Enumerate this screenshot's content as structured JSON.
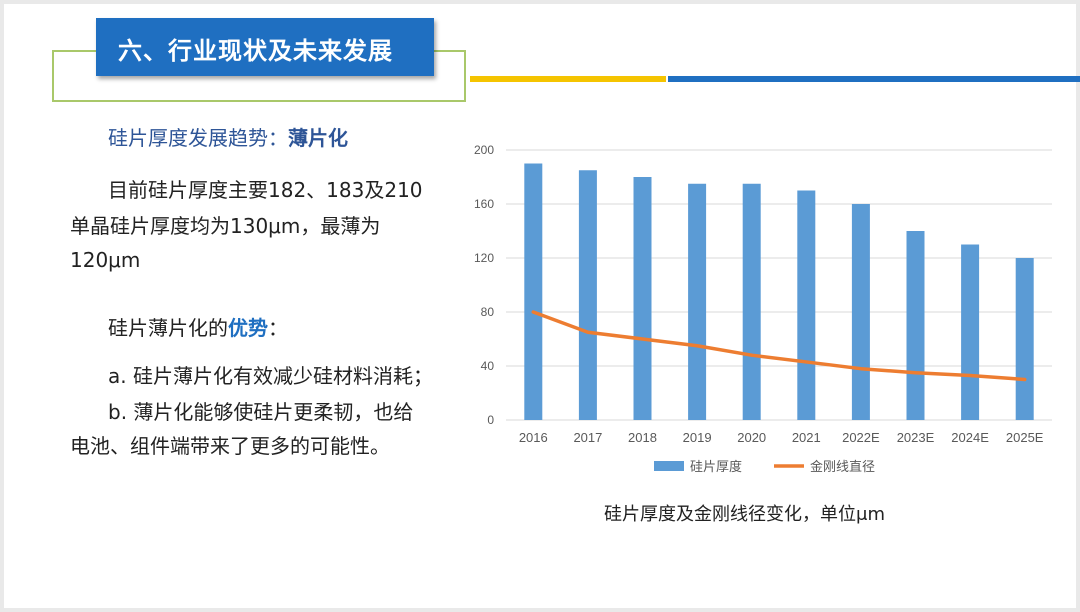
{
  "header": {
    "title": "六、行业现状及未来发展"
  },
  "text": {
    "trend_prefix": "硅片厚度发展趋势：",
    "trend_highlight": "薄片化",
    "para1_line1": "目前硅片厚度主要182、183及210",
    "para1_line2": "单晶硅片厚度均为130μm，最薄为",
    "para1_line3": "120μm",
    "adv_prefix": "硅片薄片化的",
    "adv_highlight": "优势",
    "adv_suffix": "：",
    "item_a": "a.  硅片薄片化有效减少硅材料消耗；",
    "item_b_line1": "b.  薄片化能够使硅片更柔韧，也给",
    "item_b_line2": "电池、组件端带来了更多的可能性。"
  },
  "caption": "硅片厚度及金刚线径变化，单位μm",
  "colors": {
    "bar": "#5b9bd5",
    "line": "#ed7d31",
    "title_bg": "#1f6fc1",
    "accent_yellow": "#f5c400"
  },
  "chart_data": {
    "type": "bar",
    "categories": [
      "2016",
      "2017",
      "2018",
      "2019",
      "2020",
      "2021",
      "2022E",
      "2023E",
      "2024E",
      "2025E"
    ],
    "series": [
      {
        "name": "硅片厚度",
        "type": "bar",
        "values": [
          190,
          185,
          180,
          175,
          175,
          170,
          160,
          140,
          130,
          120
        ]
      },
      {
        "name": "金刚线直径",
        "type": "line",
        "values": [
          80,
          65,
          60,
          55,
          48,
          43,
          38,
          35,
          33,
          30
        ]
      }
    ],
    "yticks": [
      0,
      40,
      80,
      120,
      160,
      200
    ],
    "ylim": [
      0,
      200
    ],
    "grid": true,
    "legend": "bottom"
  }
}
